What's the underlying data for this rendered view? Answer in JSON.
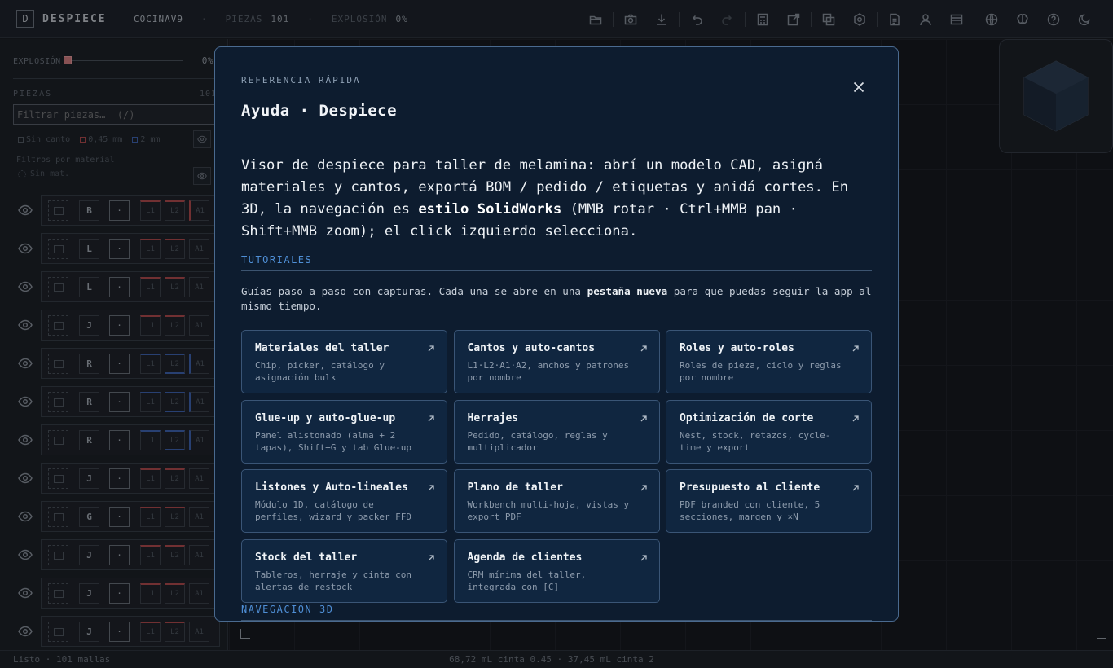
{
  "app": {
    "brand_letter": "D",
    "brand_name": "DESPIECE",
    "project": "COCINAV9",
    "sep": "·",
    "pieces_label": "PIEZAS",
    "pieces_count": "101",
    "explosion_label": "EXPLOSIÓN",
    "explosion_value": "0%"
  },
  "toolbar": [
    {
      "icon": "folder-open-icon"
    },
    {
      "icon": "camera-icon"
    },
    {
      "icon": "download-icon"
    },
    {
      "icon": "undo-icon"
    },
    {
      "icon": "redo-icon"
    },
    {
      "icon": "calculator-icon"
    },
    {
      "icon": "edit-export-icon"
    },
    {
      "icon": "layers-icon"
    },
    {
      "icon": "settings-hex-icon"
    },
    {
      "icon": "document-icon"
    },
    {
      "icon": "user-icon"
    },
    {
      "icon": "card-icon"
    },
    {
      "icon": "globe-icon"
    },
    {
      "icon": "brain-icon"
    },
    {
      "icon": "help-icon"
    },
    {
      "icon": "moon-icon"
    }
  ],
  "sidebar": {
    "explode_label": "EXPLOSIÓN",
    "explode_value": "0%",
    "explode_level": 0,
    "pieces_label": "PIEZAS",
    "pieces_count": "101",
    "filter_placeholder": "Filtrar piezas…  (/)",
    "legend": {
      "none": "Sin canto",
      "thin": "0,45 mm",
      "thick": "2 mm"
    },
    "material_filters_label": "Filtros por material",
    "no_material": "Sin mat.",
    "pieces": [
      {
        "role": "B",
        "dot": "·",
        "edges": [
          "L1",
          "L2",
          "A1"
        ]
      },
      {
        "role": "L",
        "dot": "·",
        "edges": [
          "L1",
          "L2",
          "A1"
        ]
      },
      {
        "role": "L",
        "dot": "·",
        "edges": [
          "L1",
          "L2",
          "A1"
        ]
      },
      {
        "role": "J",
        "dot": "·",
        "edges": [
          "L1",
          "L2",
          "A1"
        ]
      },
      {
        "role": "R",
        "dot": "·",
        "edges": [
          "L1",
          "L2",
          "A1"
        ]
      },
      {
        "role": "R",
        "dot": "·",
        "edges": [
          "L1",
          "L2",
          "A1"
        ]
      },
      {
        "role": "R",
        "dot": "·",
        "edges": [
          "L1",
          "L2",
          "A1"
        ]
      },
      {
        "role": "J",
        "dot": "·",
        "edges": [
          "L1",
          "L2",
          "A1"
        ]
      },
      {
        "role": "G",
        "dot": "·",
        "edges": [
          "L1",
          "L2",
          "A1"
        ]
      },
      {
        "role": "J",
        "dot": "·",
        "edges": [
          "L1",
          "L2",
          "A1"
        ]
      },
      {
        "role": "J",
        "dot": "·",
        "edges": [
          "L1",
          "L2",
          "A1"
        ]
      },
      {
        "role": "J",
        "dot": "·",
        "edges": [
          "L1",
          "L2",
          "A1"
        ]
      }
    ]
  },
  "status": {
    "left": "Listo · 101 mallas",
    "center": "68,72 mL cinta 0.45 · 37,45 mL cinta 2"
  },
  "modal": {
    "kicker": "REFERENCIA RÁPIDA",
    "title": "Ayuda · Despiece",
    "intro_a": "Visor de despiece para taller de melamina: abrí un modelo CAD, asigná materiales y cantos, exportá BOM / pedido / etiquetas y anidá cortes. En 3D, la navegación es ",
    "intro_b": "estilo SolidWorks",
    "intro_c": " (MMB rotar · Ctrl+MMB pan · Shift+MMB zoom); el click izquierdo selecciona.",
    "tutorials_head": "TUTORIALES",
    "tutorials_desc_a": "Guías paso a paso con capturas. Cada una se abre en una ",
    "tutorials_desc_b": "pestaña nueva",
    "tutorials_desc_c": " para que puedas seguir la app al mismo tiempo.",
    "tutorials": [
      {
        "title": "Materiales del taller",
        "desc": "Chip, picker, catálogo y asignación bulk"
      },
      {
        "title": "Cantos y auto-cantos",
        "desc": "L1·L2·A1·A2, anchos y patrones por nombre"
      },
      {
        "title": "Roles y auto-roles",
        "desc": "Roles de pieza, ciclo y reglas por nombre"
      },
      {
        "title": "Glue-up y auto-glue-up",
        "desc": "Panel alistonado (alma + 2 tapas), Shift+G y tab Glue-up"
      },
      {
        "title": "Herrajes",
        "desc": "Pedido, catálogo, reglas y multiplicador"
      },
      {
        "title": "Optimización de corte",
        "desc": "Nest, stock, retazos, cycle-time y export"
      },
      {
        "title": "Listones y Auto-lineales",
        "desc": "Módulo 1D, catálogo de perfiles, wizard y packer FFD"
      },
      {
        "title": "Plano de taller",
        "desc": "Workbench multi-hoja, vistas y export PDF"
      },
      {
        "title": "Presupuesto al cliente",
        "desc": "PDF branded con cliente, 5 secciones, margen y ×N"
      },
      {
        "title": "Stock del taller",
        "desc": "Tableros, herraje y cinta con alertas de restock"
      },
      {
        "title": "Agenda de clientes",
        "desc": "CRM mínima del taller, integrada con [C]"
      }
    ],
    "nav3d_head": "NAVEGACIÓN 3D"
  }
}
